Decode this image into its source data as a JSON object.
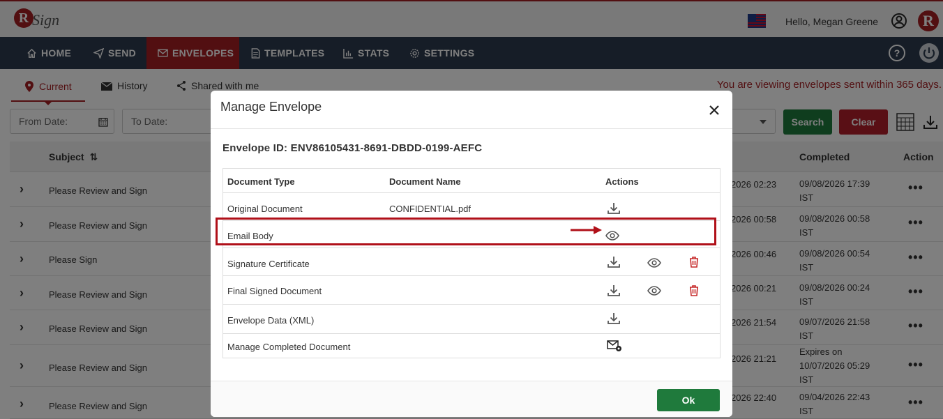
{
  "header": {
    "logo_text": "Sign",
    "logo_letter": "R",
    "greeting": "Hello, Megan Greene"
  },
  "nav": {
    "items": [
      {
        "label": "HOME"
      },
      {
        "label": "SEND"
      },
      {
        "label": "ENVELOPES"
      },
      {
        "label": "TEMPLATES"
      },
      {
        "label": "STATS"
      },
      {
        "label": "SETTINGS"
      }
    ]
  },
  "subtabs": {
    "items": [
      {
        "label": "Current"
      },
      {
        "label": "History"
      },
      {
        "label": "Shared with me"
      }
    ],
    "note": "You are viewing envelopes sent within 365 days."
  },
  "filters": {
    "from_placeholder": "From Date:",
    "to_placeholder": "To Date:",
    "search_label": "Search",
    "clear_label": "Clear"
  },
  "table": {
    "headers": {
      "subject": "Subject",
      "completed": "Completed",
      "action": "Action"
    },
    "rows": [
      {
        "subject": "Please Review and Sign",
        "sent": "2026 02:23",
        "completed": "09/08/2026 17:39 IST"
      },
      {
        "subject": "Please Review and Sign",
        "sent": "2026 00:58",
        "completed": "09/08/2026 00:58 IST"
      },
      {
        "subject": "Please Sign",
        "sent": "2026 00:46",
        "completed": "09/08/2026 00:54 IST"
      },
      {
        "subject": "Please Review and Sign",
        "sent": "2026 00:21",
        "completed": "09/08/2026 00:24 IST"
      },
      {
        "subject": "Please Review and Sign",
        "sent": "2026 21:54",
        "completed": "09/07/2026 21:58 IST"
      },
      {
        "subject": "Please Review and Sign",
        "sent": "2026 21:21",
        "completed": "Expires on 10/07/2026 05:29 IST"
      },
      {
        "subject": "Please Review and Sign",
        "sent": "2026 22:40",
        "completed": "09/04/2026 22:43 IST"
      }
    ]
  },
  "modal": {
    "title": "Manage Envelope",
    "envelope_id": "Envelope ID: ENV86105431-8691-DBDD-0199-AEFC",
    "columns": {
      "doc_type": "Document Type",
      "doc_name": "Document Name",
      "actions": "Actions"
    },
    "rows": [
      {
        "type": "Original Document",
        "name": "CONFIDENTIAL.pdf"
      },
      {
        "type": "Email Body",
        "name": ""
      },
      {
        "type": "Signature Certificate",
        "name": ""
      },
      {
        "type": "Final Signed Document",
        "name": ""
      },
      {
        "type": "Envelope Data (XML)",
        "name": ""
      },
      {
        "type": "Manage Completed Document",
        "name": ""
      }
    ],
    "ok_label": "Ok"
  },
  "colors": {
    "brand_red": "#a41e22",
    "nav_bg": "#2c3b4e",
    "success_green": "#1f7a3c",
    "danger_red": "#b21e2b",
    "highlight_red": "#b01019"
  }
}
